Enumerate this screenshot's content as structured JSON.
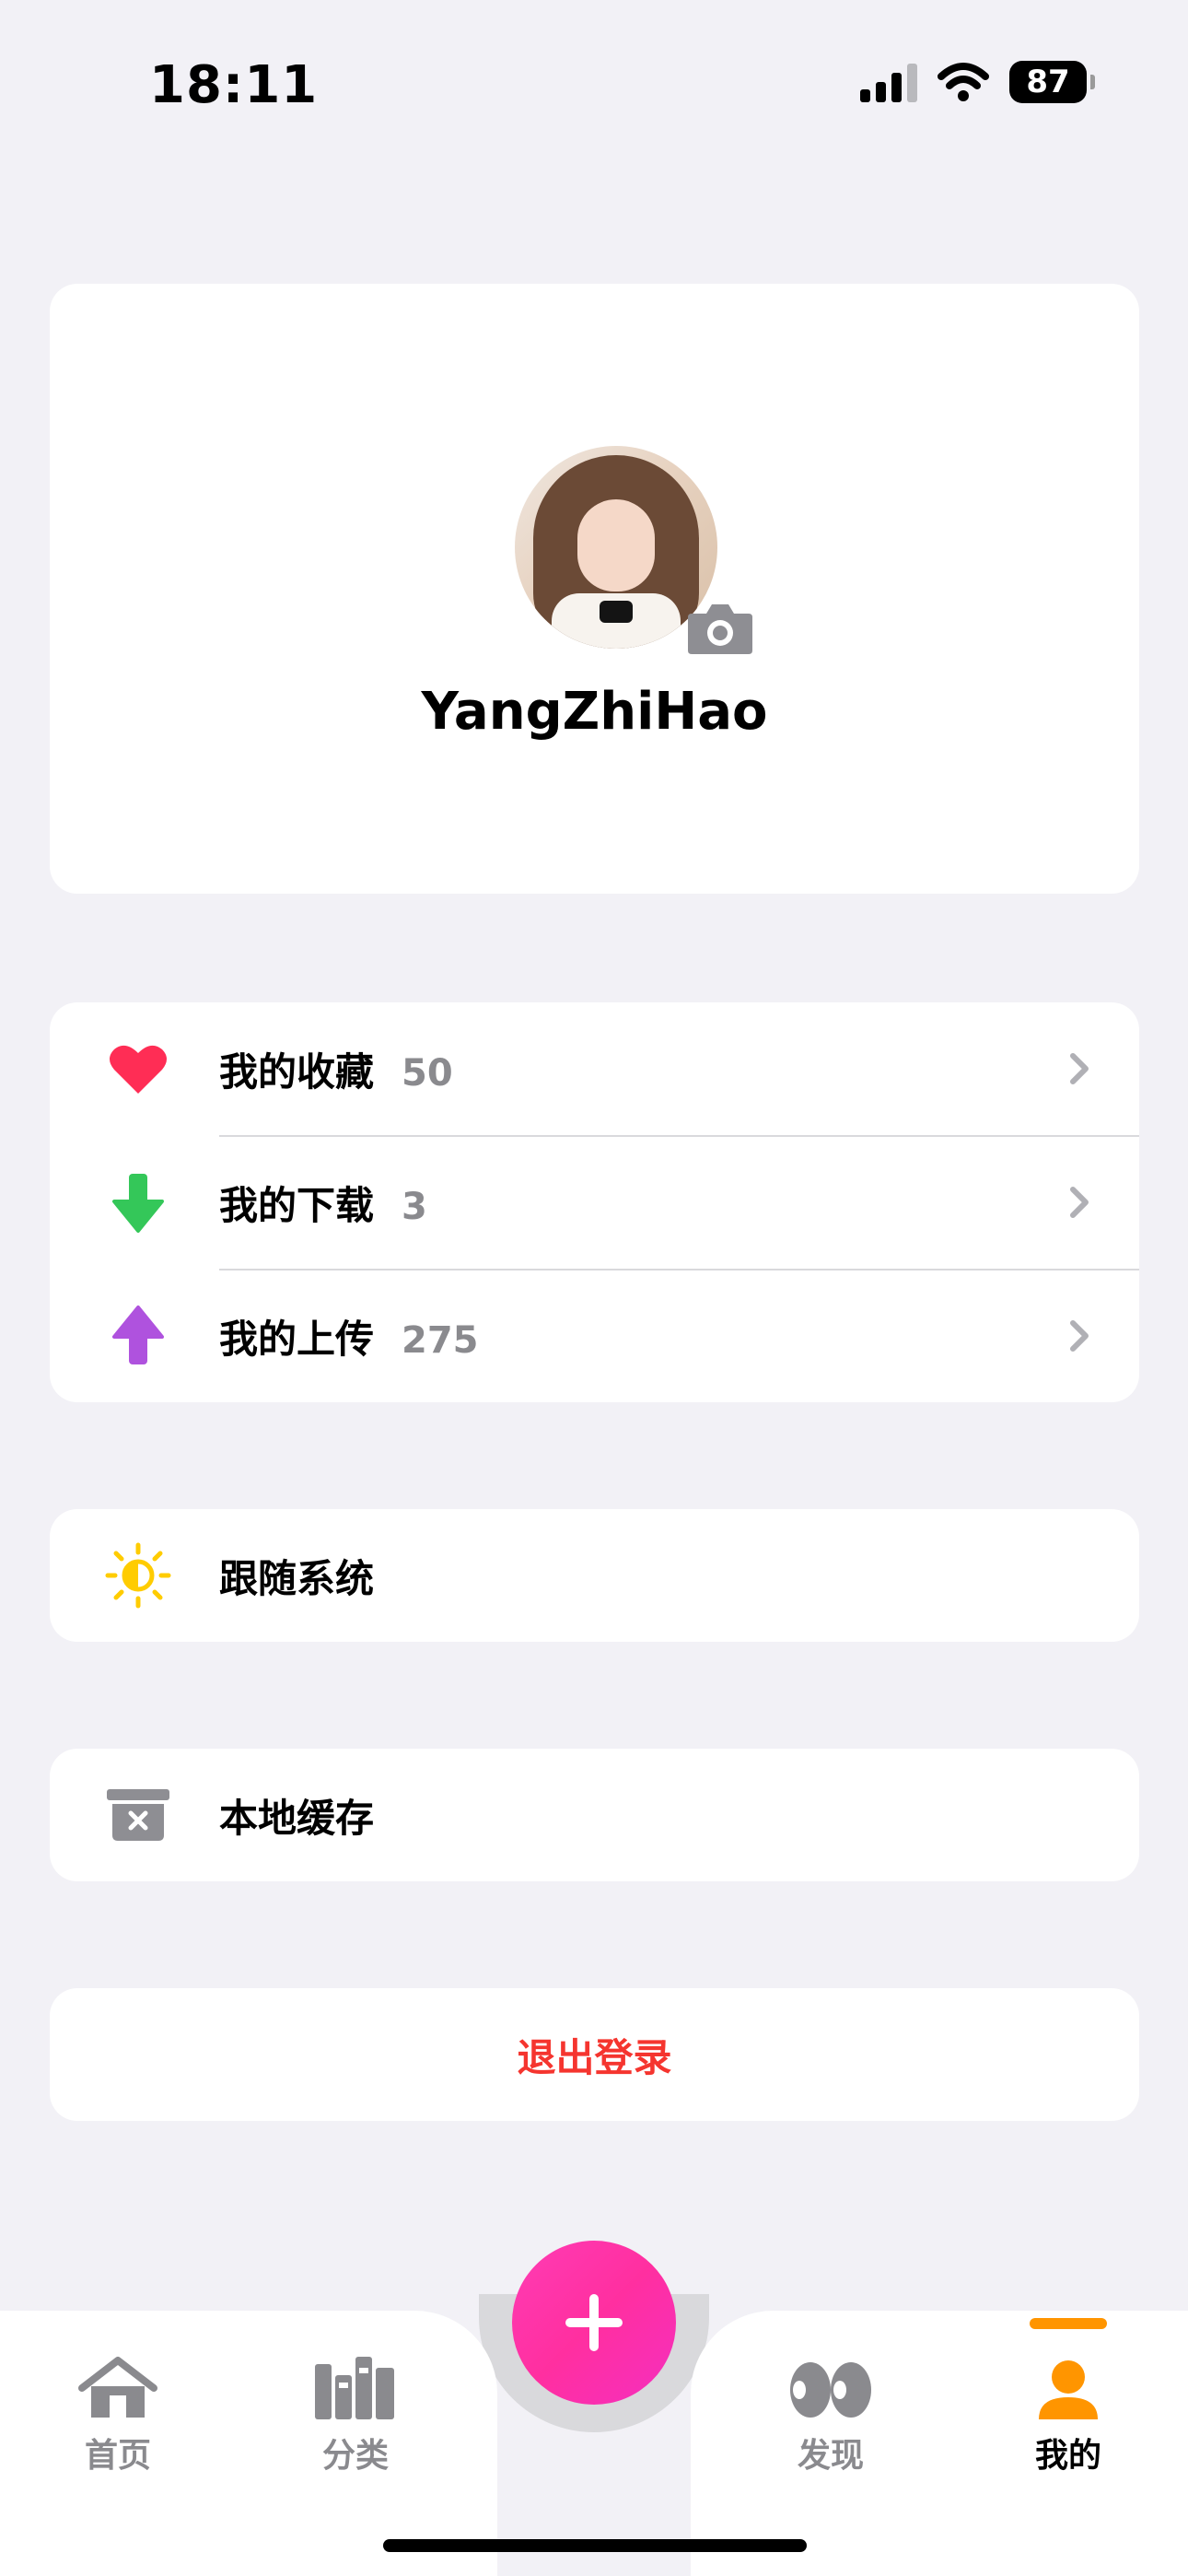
{
  "status_bar": {
    "time": "18:11",
    "battery": "87",
    "icons": [
      "cellular-signal-icon",
      "wifi-icon",
      "battery-icon"
    ]
  },
  "profile": {
    "username": "YangZhiHao",
    "avatar_icon": "user-avatar-photo",
    "camera_icon": "camera-icon"
  },
  "library": {
    "items": [
      {
        "label": "我的收藏",
        "count": "50",
        "icon": "heart-icon",
        "color": "#ff2d55"
      },
      {
        "label": "我的下载",
        "count": "3",
        "icon": "arrow-down-icon",
        "color": "#34c759"
      },
      {
        "label": "我的上传",
        "count": "275",
        "icon": "arrow-up-icon",
        "color": "#af52de"
      }
    ]
  },
  "appearance": {
    "label": "跟随系统",
    "icon": "sun-half-icon",
    "color": "#ffcc00"
  },
  "cache": {
    "label": "本地缓存",
    "icon": "clear-cache-icon"
  },
  "logout": {
    "label": "退出登录",
    "color": "#f5352f"
  },
  "tabbar": {
    "tabs": [
      {
        "label": "首页",
        "icon": "home-icon"
      },
      {
        "label": "分类",
        "icon": "books-icon"
      },
      {
        "label": "发现",
        "icon": "eyes-icon"
      },
      {
        "label": "我的",
        "icon": "person-icon",
        "active": true
      }
    ],
    "add_icon": "plus-icon",
    "accent": "#ff9500",
    "add_color": "#ff3cb4"
  }
}
